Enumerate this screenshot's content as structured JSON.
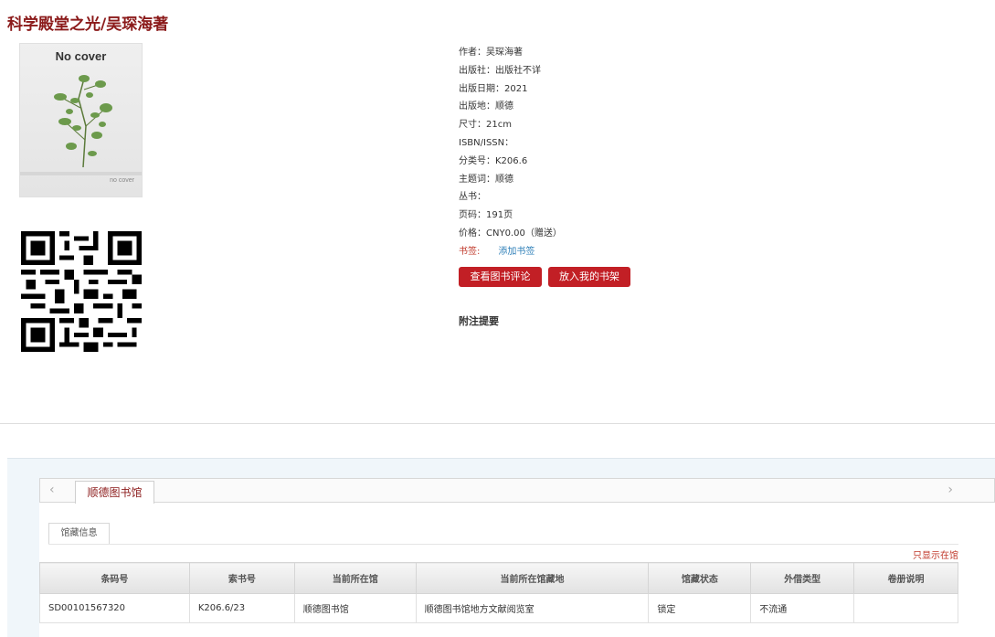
{
  "book": {
    "title": "科学殿堂之光/吴琛海著",
    "cover": {
      "title": "No cover",
      "footer": "no cover"
    }
  },
  "meta": [
    {
      "label": "作者：",
      "value": "吴琛海著"
    },
    {
      "label": "出版社：",
      "value": "出版社不详"
    },
    {
      "label": "出版日期：",
      "value": "2021"
    },
    {
      "label": "出版地：",
      "value": "顺德"
    },
    {
      "label": "尺寸：",
      "value": "21cm"
    },
    {
      "label": "ISBN/ISSN：",
      "value": ""
    },
    {
      "label": "分类号：",
      "value": "K206.6"
    },
    {
      "label": "主题词：",
      "value": "顺德"
    },
    {
      "label": "丛书：",
      "value": ""
    },
    {
      "label": "页码：",
      "value": "191页"
    },
    {
      "label": "价格：",
      "value": "CNY0.00（赠送）"
    }
  ],
  "bookmark": {
    "label": "书签:",
    "link": "添加书签"
  },
  "buttons": {
    "review": "查看图书评论",
    "shelf": "放入我的书架"
  },
  "abstract_label": "附注提要",
  "library_tab": "顺德图书馆",
  "holding_tab": "馆藏信息",
  "only_show": "只显示在馆",
  "table": {
    "headers": [
      "条码号",
      "索书号",
      "当前所在馆",
      "当前所在馆藏地",
      "馆藏状态",
      "外借类型",
      "卷册说明"
    ],
    "rows": [
      [
        "SD00101567320",
        "K206.6/23",
        "顺德图书馆",
        "顺德图书馆地方文献阅览室",
        "锁定",
        "不流通",
        ""
      ]
    ]
  },
  "icons": {
    "prev": "chevron-left-icon",
    "next": "chevron-right-icon"
  },
  "colors": {
    "accent": "#c21f25",
    "title": "#8b1a1a",
    "link": "#2e7fb8"
  }
}
